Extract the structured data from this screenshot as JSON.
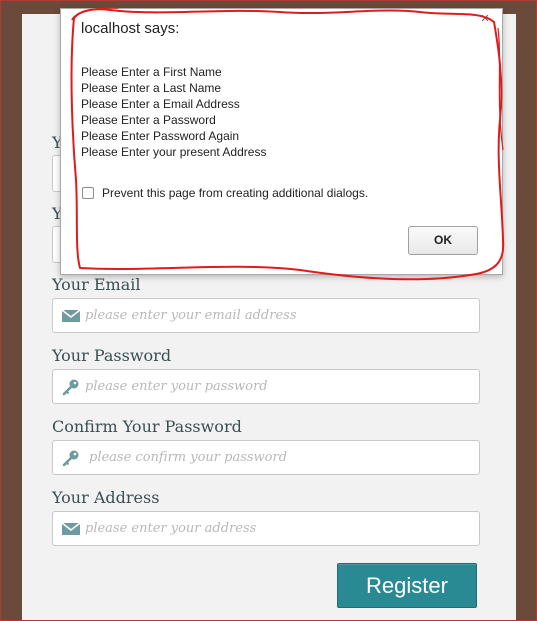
{
  "form": {
    "partial_label_1": "Y",
    "partial_label_2": "Y",
    "email": {
      "label": "Your Email",
      "placeholder": "please enter your email address",
      "icon": "envelope-icon"
    },
    "password": {
      "label": "Your Password",
      "placeholder": "please enter your password",
      "icon": "key-icon"
    },
    "confirm_password": {
      "label": "Confirm Your Password",
      "placeholder": "please confirm your password",
      "icon": "key-icon"
    },
    "address": {
      "label": "Your Address",
      "placeholder": "please enter your address",
      "icon": "envelope-icon"
    },
    "register_label": "Register"
  },
  "dialog": {
    "title": "localhost says:",
    "close": "×",
    "messages": [
      "Please Enter a First Name",
      "Please Enter a Last Name",
      "Please Enter a Email Address",
      "Please Enter a Password",
      "Please Enter Password Again",
      "Please Enter your present Address"
    ],
    "checkbox_label": "Prevent this page from creating additional dialogs.",
    "ok_label": "OK"
  },
  "colors": {
    "background": "#6a4a3b",
    "panel": "#f2f2f2",
    "accent": "#2a8a94",
    "label_text": "#3a4f52",
    "icon": "#6e9aa0",
    "annotation": "#e01b1b"
  }
}
